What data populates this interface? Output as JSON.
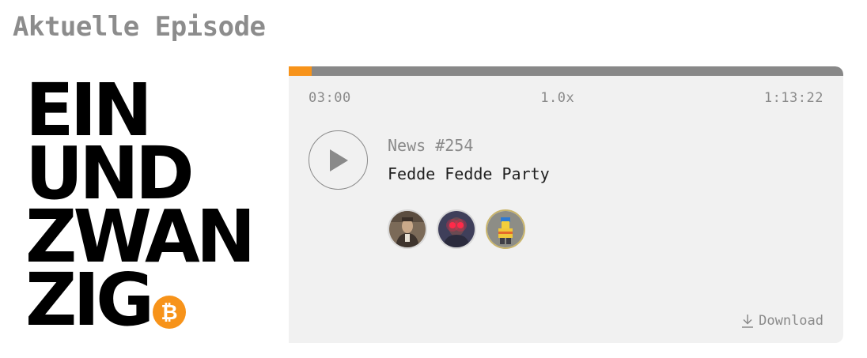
{
  "section": {
    "title": "Aktuelle Episode"
  },
  "logo": {
    "lines": [
      "EIN",
      "UND",
      "ZWAN",
      "ZIG"
    ],
    "badge_icon": "bitcoin-icon",
    "badge_color": "#f7931a"
  },
  "player": {
    "progress_fraction": 0.041,
    "progress_color": "#f7931a",
    "track_color": "#888888",
    "current_time": "03:00",
    "speed": "1.0x",
    "duration": "1:13:22",
    "play_icon": "play-icon",
    "episode_number": "News #254",
    "episode_title": "Fedde Fedde Party",
    "contributors": [
      {
        "icon": "avatar-portrait"
      },
      {
        "icon": "avatar-laser-eyes"
      },
      {
        "icon": "avatar-lego-figure"
      }
    ],
    "download_icon": "download-icon",
    "download_label": "Download"
  }
}
